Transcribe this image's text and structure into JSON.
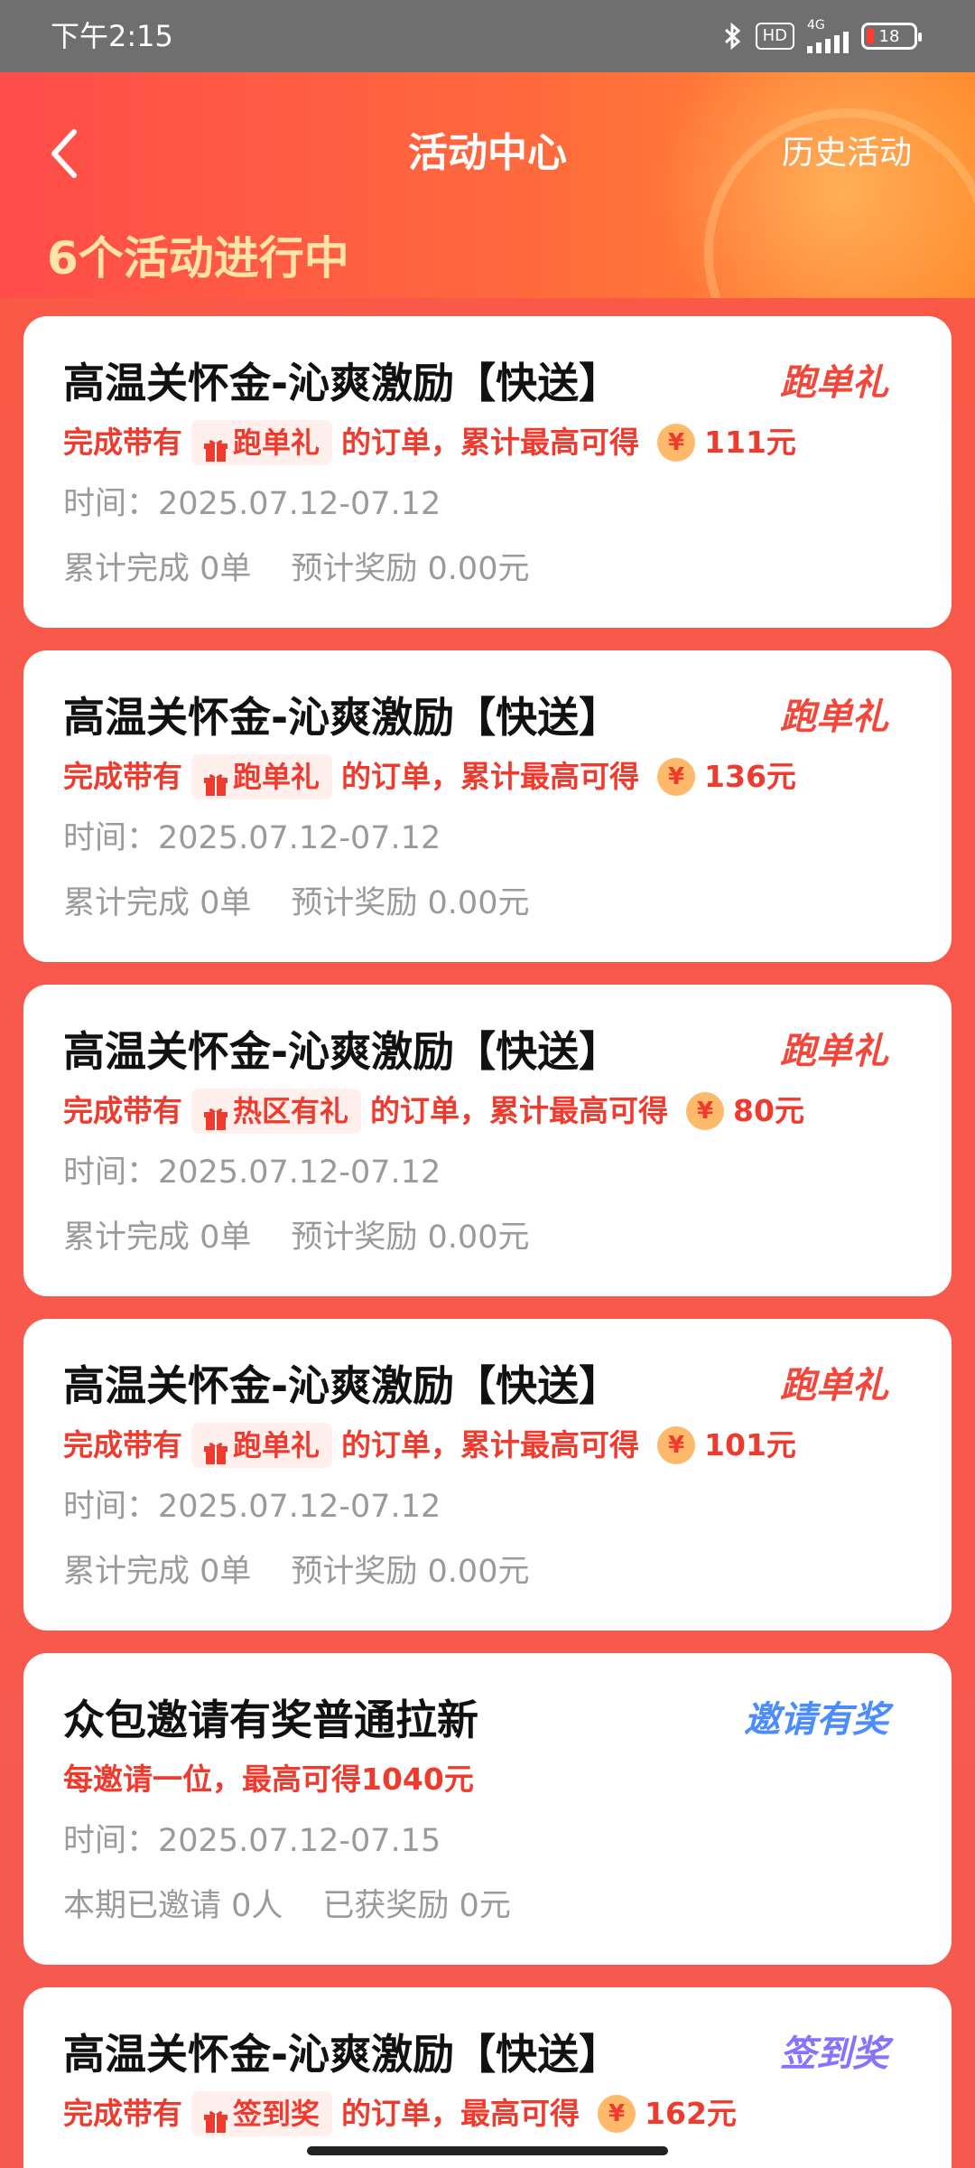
{
  "status_bar": {
    "time": "下午2:15",
    "network": "4G",
    "hd": "HD",
    "battery": "18"
  },
  "header": {
    "title": "活动中心",
    "history_link": "历史活动",
    "active_count": "6个活动进行中"
  },
  "colors": {
    "accent_red": "#ef3a2e",
    "tag_red": "#f2473a",
    "tag_blue": "#4b8cff",
    "tag_purple": "#8a72ff",
    "active_count_yellow": "#ffe3a7"
  },
  "cards": [
    {
      "title": "高温关怀金-沁爽激励【快送】",
      "tag": "跑单礼",
      "desc_prefix": "完成带有",
      "chip": "跑单礼",
      "desc_middle": "的订单，累计最高可得",
      "coin": "¥",
      "amount": "111元",
      "time": "时间：2025.07.12-07.12",
      "stat1": "累计完成 0单",
      "stat2": "预计奖励 0.00元"
    },
    {
      "title": "高温关怀金-沁爽激励【快送】",
      "tag": "跑单礼",
      "desc_prefix": "完成带有",
      "chip": "跑单礼",
      "desc_middle": "的订单，累计最高可得",
      "coin": "¥",
      "amount": "136元",
      "time": "时间：2025.07.12-07.12",
      "stat1": "累计完成 0单",
      "stat2": "预计奖励 0.00元"
    },
    {
      "title": "高温关怀金-沁爽激励【快送】",
      "tag": "跑单礼",
      "desc_prefix": "完成带有",
      "chip": "热区有礼",
      "desc_middle": "的订单，累计最高可得",
      "coin": "¥",
      "amount": "80元",
      "time": "时间：2025.07.12-07.12",
      "stat1": "累计完成 0单",
      "stat2": "预计奖励 0.00元"
    },
    {
      "title": "高温关怀金-沁爽激励【快送】",
      "tag": "跑单礼",
      "desc_prefix": "完成带有",
      "chip": "跑单礼",
      "desc_middle": "的订单，累计最高可得",
      "coin": "¥",
      "amount": "101元",
      "time": "时间：2025.07.12-07.12",
      "stat1": "累计完成 0单",
      "stat2": "预计奖励 0.00元"
    },
    {
      "title": "众包邀请有奖普通拉新",
      "tag": "邀请有奖",
      "desc_text": "每邀请一位，最高可得1040元",
      "time": "时间：2025.07.12-07.15",
      "stat1": "本期已邀请 0人",
      "stat2": "已获奖励 0元"
    },
    {
      "title": "高温关怀金-沁爽激励【快送】",
      "tag": "签到奖",
      "desc_prefix": "完成带有",
      "chip": "签到奖",
      "desc_middle": "的订单，最高可得",
      "coin": "¥",
      "amount": "162元"
    }
  ]
}
